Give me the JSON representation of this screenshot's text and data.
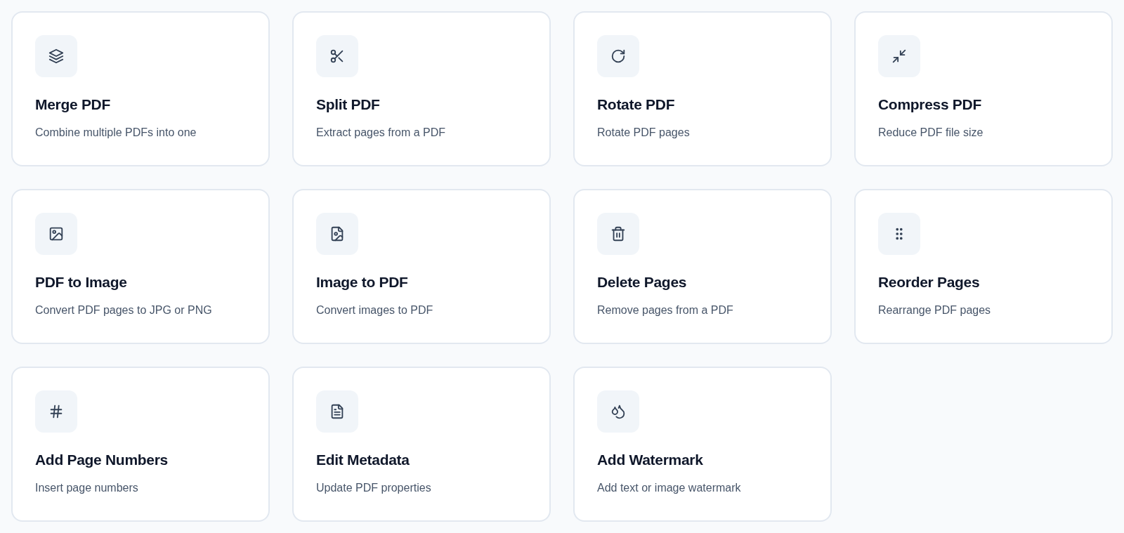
{
  "tools": [
    {
      "title": "Merge PDF",
      "description": "Combine multiple PDFs into one"
    },
    {
      "title": "Split PDF",
      "description": "Extract pages from a PDF"
    },
    {
      "title": "Rotate PDF",
      "description": "Rotate PDF pages"
    },
    {
      "title": "Compress PDF",
      "description": "Reduce PDF file size"
    },
    {
      "title": "PDF to Image",
      "description": "Convert PDF pages to JPG or PNG"
    },
    {
      "title": "Image to PDF",
      "description": "Convert images to PDF"
    },
    {
      "title": "Delete Pages",
      "description": "Remove pages from a PDF"
    },
    {
      "title": "Reorder Pages",
      "description": "Rearrange PDF pages"
    },
    {
      "title": "Add Page Numbers",
      "description": "Insert page numbers"
    },
    {
      "title": "Edit Metadata",
      "description": "Update PDF properties"
    },
    {
      "title": "Add Watermark",
      "description": "Add text or image watermark"
    }
  ]
}
